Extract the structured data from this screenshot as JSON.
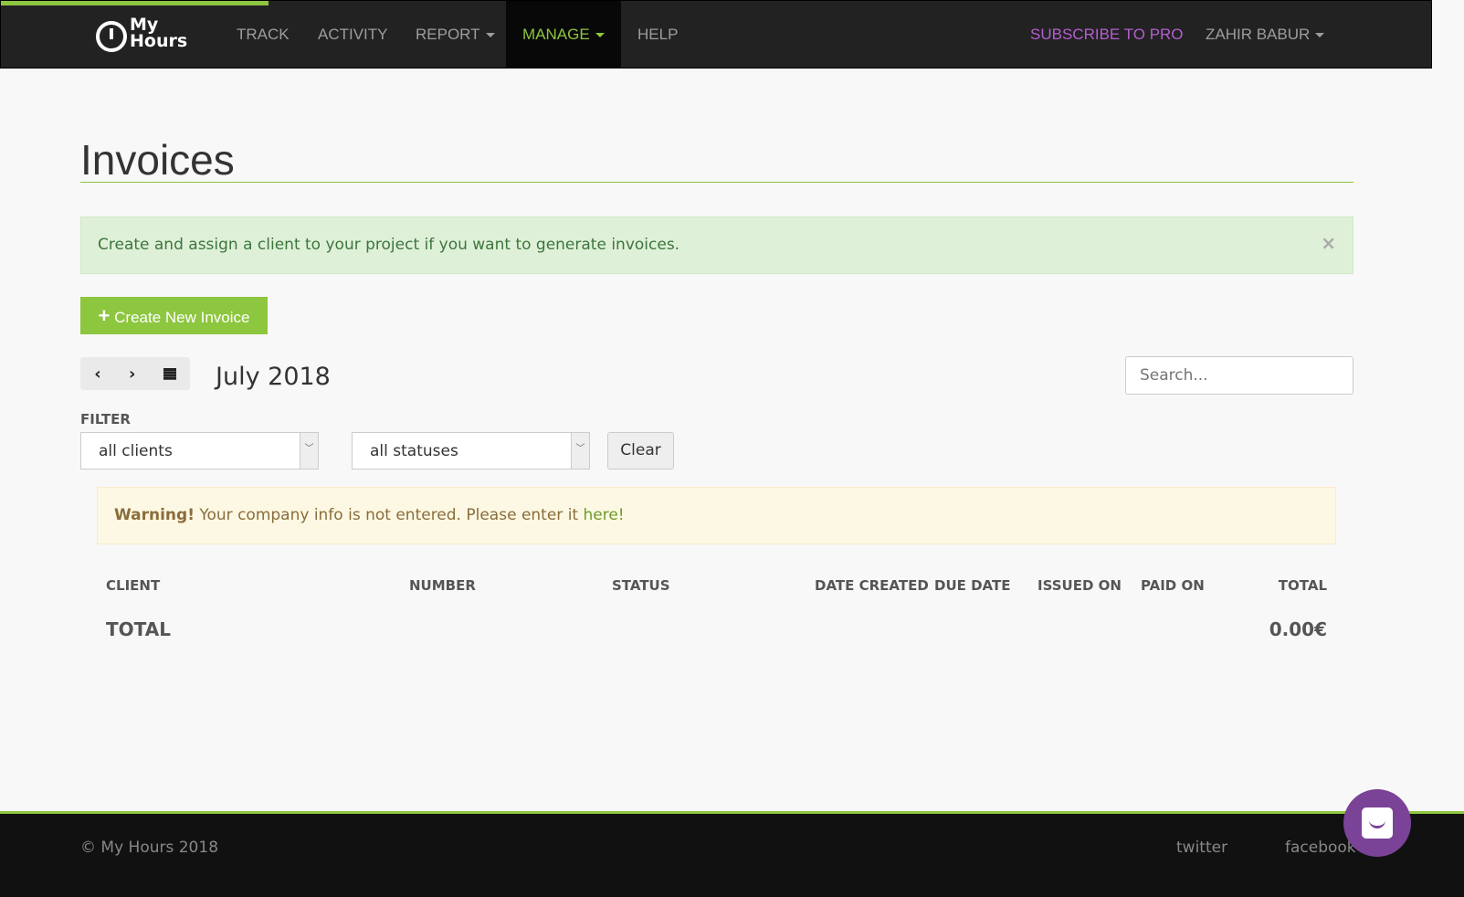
{
  "nav": {
    "logo": "My Hours",
    "items": [
      "TRACK",
      "ACTIVITY",
      "REPORT",
      "MANAGE",
      "HELP"
    ],
    "subscribe": "SUBSCRIBE TO PRO",
    "user": "ZAHIR BABUR"
  },
  "page": {
    "title": "Invoices"
  },
  "alert": {
    "text": "Create and assign a client to your project if you want to generate invoices.",
    "close": "×"
  },
  "create_button": "Create New Invoice",
  "date": {
    "month": "July 2018"
  },
  "search": {
    "placeholder": "Search..."
  },
  "filter": {
    "label": "FILTER",
    "clients": "all clients",
    "statuses": "all statuses",
    "clear": "Clear"
  },
  "warning": {
    "strong": "Warning!",
    "text": " Your company info is not entered. Please enter it ",
    "link": "here!"
  },
  "table": {
    "headers": [
      "CLIENT",
      "NUMBER",
      "STATUS",
      "DATE CREATED",
      "DUE DATE",
      "ISSUED ON",
      "PAID ON",
      "TOTAL"
    ],
    "total_label": "TOTAL",
    "total_value": "0.00€"
  },
  "footer": {
    "copyright": "© My Hours 2018",
    "twitter": "twitter",
    "facebook": "facebook"
  },
  "colors": {
    "accent": "#8dc63f",
    "subscribe": "#b45ed3",
    "chat": "#7b4397"
  }
}
